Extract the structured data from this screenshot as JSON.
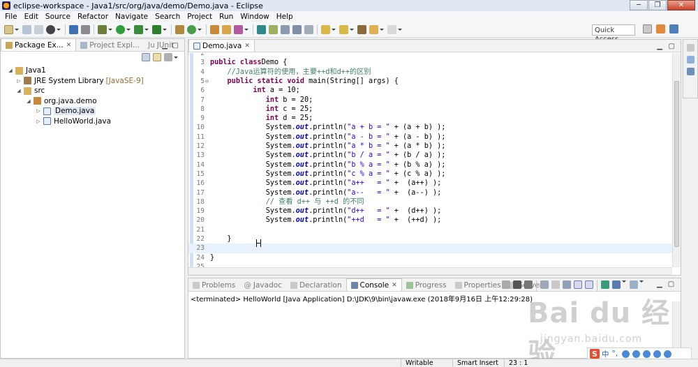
{
  "window": {
    "title": "eclipse-workspace - Java1/src/org/java/demo/Demo.java - Eclipse"
  },
  "menu": [
    "File",
    "Edit",
    "Source",
    "Refactor",
    "Navigate",
    "Search",
    "Project",
    "Run",
    "Window",
    "Help"
  ],
  "toolbar": {
    "quick_access": "Quick Access"
  },
  "left_panel": {
    "tabs": [
      {
        "label": "Package Ex..."
      },
      {
        "label": "Project Expl..."
      },
      {
        "label": "JUnit",
        "prefix": "Ju"
      }
    ],
    "tree": [
      {
        "label": "Java1"
      },
      {
        "label": "JRE System Library",
        "decoration": "[JavaSE-9]"
      },
      {
        "label": "src"
      },
      {
        "label": "org.java.demo"
      },
      {
        "label": "Demo.java"
      },
      {
        "label": "HelloWorld.java"
      }
    ]
  },
  "editor": {
    "tab_label": "Demo.java",
    "lines": [
      {
        "n": "2",
        "parts": []
      },
      {
        "n": "3",
        "parts": [
          [
            "kw",
            "public class"
          ],
          [
            "",
            "Demo {"
          ]
        ]
      },
      {
        "n": "4",
        "parts": [
          [
            "cm",
            "    //Java运算符的使用，主要++d和d++的区别"
          ]
        ]
      },
      {
        "n": "5",
        "fold": "⊖",
        "parts": [
          [
            "",
            "    "
          ],
          [
            "kw",
            "public static void"
          ],
          [
            "",
            " main(String[] args) {"
          ]
        ]
      },
      {
        "n": "6",
        "parts": [
          [
            "",
            "          "
          ],
          [
            "kw",
            "int"
          ],
          [
            "",
            " a = 10;"
          ]
        ]
      },
      {
        "n": "7",
        "parts": [
          [
            "",
            "             "
          ],
          [
            "kw",
            "int"
          ],
          [
            "",
            " b = 20;"
          ]
        ]
      },
      {
        "n": "8",
        "parts": [
          [
            "",
            "             "
          ],
          [
            "kw",
            "int"
          ],
          [
            "",
            " c = 25;"
          ]
        ]
      },
      {
        "n": "9",
        "parts": [
          [
            "",
            "             "
          ],
          [
            "kw",
            "int"
          ],
          [
            "",
            " d = 25;"
          ]
        ]
      },
      {
        "n": "10",
        "parts": [
          [
            "",
            "             System."
          ],
          [
            "fld",
            "out"
          ],
          [
            "",
            ".println("
          ],
          [
            "st",
            "\"a + b = \""
          ],
          [
            "",
            " + (a + b) );"
          ]
        ]
      },
      {
        "n": "11",
        "parts": [
          [
            "",
            "             System."
          ],
          [
            "fld",
            "out"
          ],
          [
            "",
            ".println("
          ],
          [
            "st",
            "\"a - b = \""
          ],
          [
            "",
            " + (a - b) );"
          ]
        ]
      },
      {
        "n": "12",
        "parts": [
          [
            "",
            "             System."
          ],
          [
            "fld",
            "out"
          ],
          [
            "",
            ".println("
          ],
          [
            "st",
            "\"a * b = \""
          ],
          [
            "",
            " + (a * b) );"
          ]
        ]
      },
      {
        "n": "13",
        "parts": [
          [
            "",
            "             System."
          ],
          [
            "fld",
            "out"
          ],
          [
            "",
            ".println("
          ],
          [
            "st",
            "\"b / a = \""
          ],
          [
            "",
            " + (b / a) );"
          ]
        ]
      },
      {
        "n": "14",
        "parts": [
          [
            "",
            "             System."
          ],
          [
            "fld",
            "out"
          ],
          [
            "",
            ".println("
          ],
          [
            "st",
            "\"b % a = \""
          ],
          [
            "",
            " + (b % a) );"
          ]
        ]
      },
      {
        "n": "15",
        "parts": [
          [
            "",
            "             System."
          ],
          [
            "fld",
            "out"
          ],
          [
            "",
            ".println("
          ],
          [
            "st",
            "\"c % a = \""
          ],
          [
            "",
            " + (c % a) );"
          ]
        ]
      },
      {
        "n": "16",
        "parts": [
          [
            "",
            "             System."
          ],
          [
            "fld",
            "out"
          ],
          [
            "",
            ".println("
          ],
          [
            "st",
            "\"a++   = \""
          ],
          [
            "",
            " +  (a++) );"
          ]
        ]
      },
      {
        "n": "17",
        "parts": [
          [
            "",
            "             System."
          ],
          [
            "fld",
            "out"
          ],
          [
            "",
            ".println("
          ],
          [
            "st",
            "\"a--   = \""
          ],
          [
            "",
            " +  (a--) );"
          ]
        ]
      },
      {
        "n": "18",
        "parts": [
          [
            "cm",
            "             // 查看 d++ 与 ++d 的不同"
          ]
        ]
      },
      {
        "n": "19",
        "parts": [
          [
            "",
            "             System."
          ],
          [
            "fld",
            "out"
          ],
          [
            "",
            ".println("
          ],
          [
            "st",
            "\"d++   = \""
          ],
          [
            "",
            " +  (d++) );"
          ]
        ]
      },
      {
        "n": "20",
        "parts": [
          [
            "",
            "             System."
          ],
          [
            "fld",
            "out"
          ],
          [
            "",
            ".println("
          ],
          [
            "st",
            "\"++d   = \""
          ],
          [
            "",
            " +  (++d) );"
          ]
        ]
      },
      {
        "n": "21",
        "parts": []
      },
      {
        "n": "22",
        "parts": [
          [
            "",
            "    }"
          ]
        ]
      },
      {
        "n": "23",
        "parts": [],
        "current": true
      },
      {
        "n": "24",
        "parts": [
          [
            "",
            "}"
          ]
        ]
      },
      {
        "n": "25",
        "parts": []
      }
    ]
  },
  "console": {
    "tabs": [
      {
        "label": "Problems"
      },
      {
        "label": "Javadoc",
        "prefix": "@"
      },
      {
        "label": "Declaration"
      },
      {
        "label": "Console",
        "active": true
      },
      {
        "label": "Progress"
      },
      {
        "label": "Properties"
      },
      {
        "label": "Servers"
      }
    ],
    "output": "<terminated> HelloWorld [Java Application] D:\\JDK\\9\\bin\\javaw.exe (2018年9月16日 上午12:29:28)"
  },
  "statusbar": {
    "writable": "Writable",
    "insert_mode": "Smart Insert",
    "position": "23 : 1"
  },
  "watermark": {
    "logo": "Bai du 经验",
    "sub": "jingyan.baidu.com"
  },
  "ime": {
    "logo": "S",
    "text": "中",
    "extra": "°,"
  },
  "colors": {
    "keyword": "#7f0055",
    "comment": "#3f7f5f",
    "string": "#2a00ff",
    "field": "#0000c0",
    "current_line": "#e8f2fe"
  }
}
